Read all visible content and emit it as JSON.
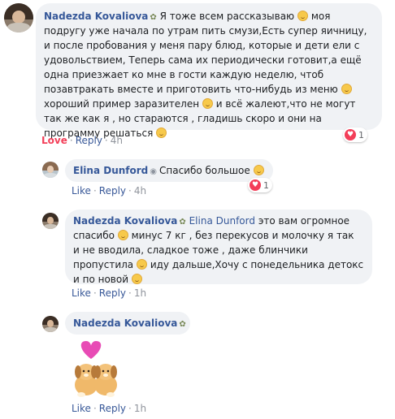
{
  "comment1": {
    "author": "Nadezda Kovaliova",
    "lines": [
      "Я тоже всем рассказываю",
      "подругу уже начала по утрам пить смузи,Есть супер яичницу,",
      "и после пробования у меня пару блюд, которые и дети ели с",
      "удовольствием, Теперь сама их периодически готовит,а ещё",
      "одна приезжает ко мне в гости каждую неделю, чтоб",
      "позавтракать вместе и приготовить что-нибудь из меню",
      "хороший пример заразителен",
      "и всё жалеют,что не могут",
      "так же как я , но стараются , гладишь скоро и они на",
      "программу решаться"
    ],
    "line1_tail": "моя",
    "reaction_count": "1",
    "action_love": "Love",
    "action_reply": "Reply",
    "time": "4h"
  },
  "comment2": {
    "author": "Elina Dunford",
    "text": "Спасибо большое",
    "reaction_count": "1",
    "action_like": "Like",
    "action_reply": "Reply",
    "time": "4h"
  },
  "comment3": {
    "author": "Nadezda Kovaliova",
    "mention": "Elina Dunford",
    "line1": "это вам огромное",
    "line2a": "спасибо",
    "line2b": "минус 7 кг , без перекусов и молочку я так",
    "line3": "и не вводила, сладкое тоже , даже блинчики",
    "line4a": "пропустила",
    "line4b": "иду дальше,Хочу с понедельника детокс",
    "line5": "и по новой",
    "action_like": "Like",
    "action_reply": "Reply",
    "time": "1h"
  },
  "comment4": {
    "author": "Nadezda Kovaliova",
    "action_like": "Like",
    "action_reply": "Reply",
    "time": "1h"
  },
  "colors": {
    "author": "#365899",
    "link": "#385898",
    "love": "#f33e58",
    "bubble": "#f0f2f5"
  }
}
